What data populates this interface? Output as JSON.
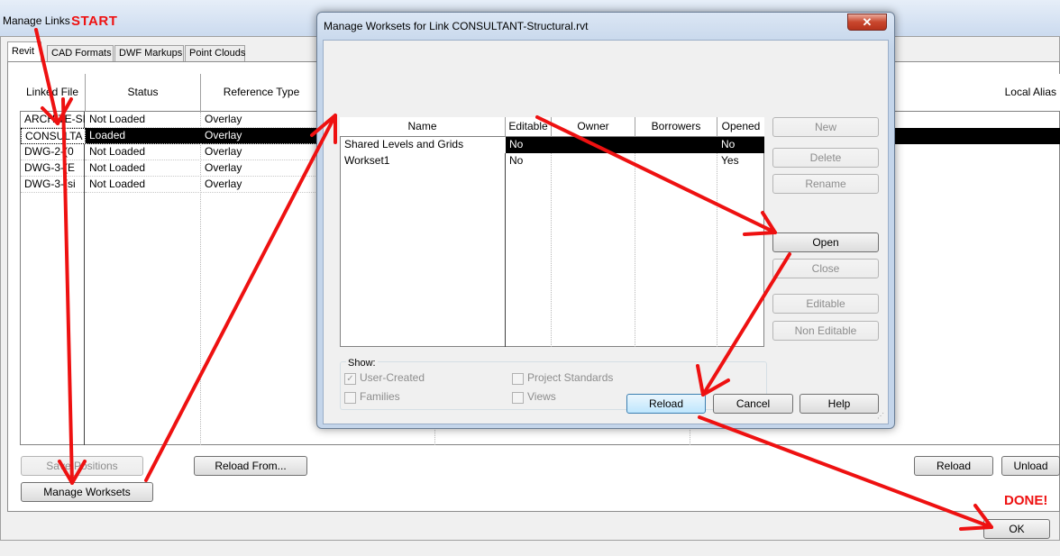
{
  "manage_links": {
    "title": "Manage Links",
    "annotation_start": "START",
    "annotation_done": "DONE!",
    "tabs": [
      "Revit",
      "CAD Formats",
      "DWF Markups",
      "Point Clouds"
    ],
    "columns": [
      "Linked File",
      "Status",
      "Reference Type",
      "Local Alias"
    ],
    "rows": [
      {
        "file": "ARCHITE-SI",
        "status": "Not Loaded",
        "ref": "Overlay"
      },
      {
        "file": "CONSULTA",
        "status": "Loaded",
        "ref": "Overlay",
        "selected": true
      },
      {
        "file": "DWG-2-(0",
        "status": "Not Loaded",
        "ref": "Overlay"
      },
      {
        "file": "DWG-3-(E",
        "status": "Not Loaded",
        "ref": "Overlay"
      },
      {
        "file": "DWG-3-(si",
        "status": "Not Loaded",
        "ref": "Overlay"
      }
    ],
    "buttons": {
      "save_positions": "Save Positions",
      "reload_from": "Reload From...",
      "manage_worksets": "Manage Worksets",
      "reload": "Reload",
      "unload": "Unload",
      "ok": "OK"
    }
  },
  "manage_worksets": {
    "title": "Manage Worksets for Link CONSULTANT-Structural.rvt",
    "close_glyph": "✕",
    "columns": [
      "Name",
      "Editable",
      "Owner",
      "Borrowers",
      "Opened"
    ],
    "rows": [
      {
        "name": "Shared Levels and Grids",
        "editable": "No",
        "owner": "",
        "borrowers": "",
        "opened": "No",
        "selected": true
      },
      {
        "name": "Workset1",
        "editable": "No",
        "owner": "",
        "borrowers": "",
        "opened": "Yes"
      }
    ],
    "side_buttons": {
      "new": "New",
      "delete": "Delete",
      "rename": "Rename",
      "open": "Open",
      "close": "Close",
      "editable": "Editable",
      "non_editable": "Non Editable"
    },
    "show": {
      "label": "Show:",
      "user_created": "User-Created",
      "families": "Families",
      "project_standards": "Project Standards",
      "views": "Views"
    },
    "bottom_buttons": {
      "reload": "Reload",
      "cancel": "Cancel",
      "help": "Help"
    }
  },
  "colors": {
    "annotation_red": "#ee1111",
    "selection": "#000000"
  }
}
